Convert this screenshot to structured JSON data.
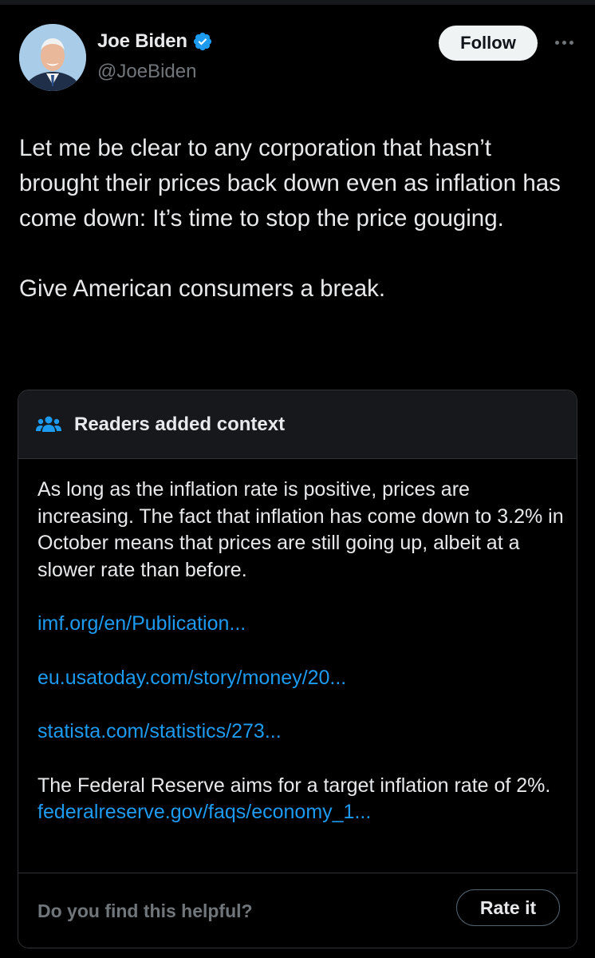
{
  "author": {
    "display_name": "Joe Biden",
    "handle": "@JoeBiden",
    "verified_icon": "verified-badge-icon"
  },
  "actions": {
    "follow_label": "Follow",
    "more_icon": "more-options-icon"
  },
  "tweet": {
    "text": "Let me be clear to any corporation that hasn’t brought their prices back down even as inflation has come down: It’s time to stop the price gouging.\n\nGive American consumers a break."
  },
  "community_note": {
    "icon": "people-icon",
    "title": "Readers added context",
    "paragraph_1": "As long as the inflation rate is positive, prices are increasing. The fact that inflation has come down to 3.2% in October means that prices are still going up, albeit at a slower rate than before.",
    "links": [
      "imf.org/en/Publication...",
      "eu.usatoday.com/story/money/20...",
      "statista.com/statistics/273..."
    ],
    "paragraph_2": "The Federal Reserve aims for a target inflation rate of 2%.",
    "link_4": "federalreserve.gov/faqs/economy_1...",
    "helpful_question": "Do you find this helpful?",
    "rate_label": "Rate it"
  },
  "colors": {
    "background": "#000000",
    "text": "#e7e9ea",
    "muted": "#71767b",
    "link": "#1d9bf0",
    "verified": "#1d9bf0"
  }
}
